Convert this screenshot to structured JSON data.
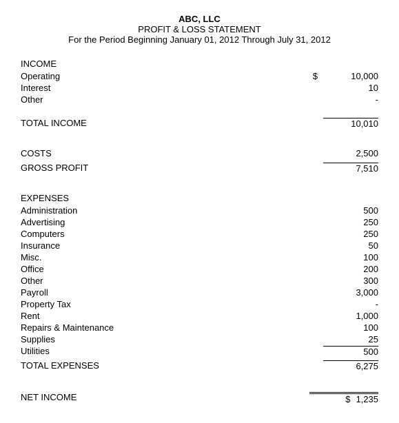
{
  "header": {
    "company": "ABC, LLC",
    "statement": "PROFIT & LOSS STATEMENT",
    "period": "For the Period Beginning January 01, 2012 Through  July 31, 2012"
  },
  "income": {
    "label": "INCOME",
    "items": [
      {
        "label": "Operating",
        "value": "10,000",
        "dollar": "$"
      },
      {
        "label": "Interest",
        "value": "10",
        "dollar": ""
      },
      {
        "label": "Other",
        "value": "-",
        "dollar": ""
      }
    ],
    "total_label": "TOTAL INCOME",
    "total_value": "10,010"
  },
  "costs": {
    "label": "COSTS",
    "value": "2,500"
  },
  "gross_profit": {
    "label": "GROSS PROFIT",
    "value": "7,510"
  },
  "expenses": {
    "label": "EXPENSES",
    "items": [
      {
        "label": "Administration",
        "value": "500"
      },
      {
        "label": "Advertising",
        "value": "250"
      },
      {
        "label": "Computers",
        "value": "250"
      },
      {
        "label": "Insurance",
        "value": "50"
      },
      {
        "label": "Misc.",
        "value": "100"
      },
      {
        "label": "Office",
        "value": "200"
      },
      {
        "label": "Other",
        "value": "300"
      },
      {
        "label": "Payroll",
        "value": "3,000"
      },
      {
        "label": "Property Tax",
        "value": "-"
      },
      {
        "label": "Rent",
        "value": "1,000"
      },
      {
        "label": "Repairs & Maintenance",
        "value": "100"
      },
      {
        "label": "Supplies",
        "value": "25"
      },
      {
        "label": "Utilities",
        "value": "500"
      }
    ],
    "total_label": "TOTAL EXPENSES",
    "total_value": "6,275"
  },
  "net_income": {
    "label": "NET INCOME",
    "dollar": "$",
    "value": "1,235"
  }
}
